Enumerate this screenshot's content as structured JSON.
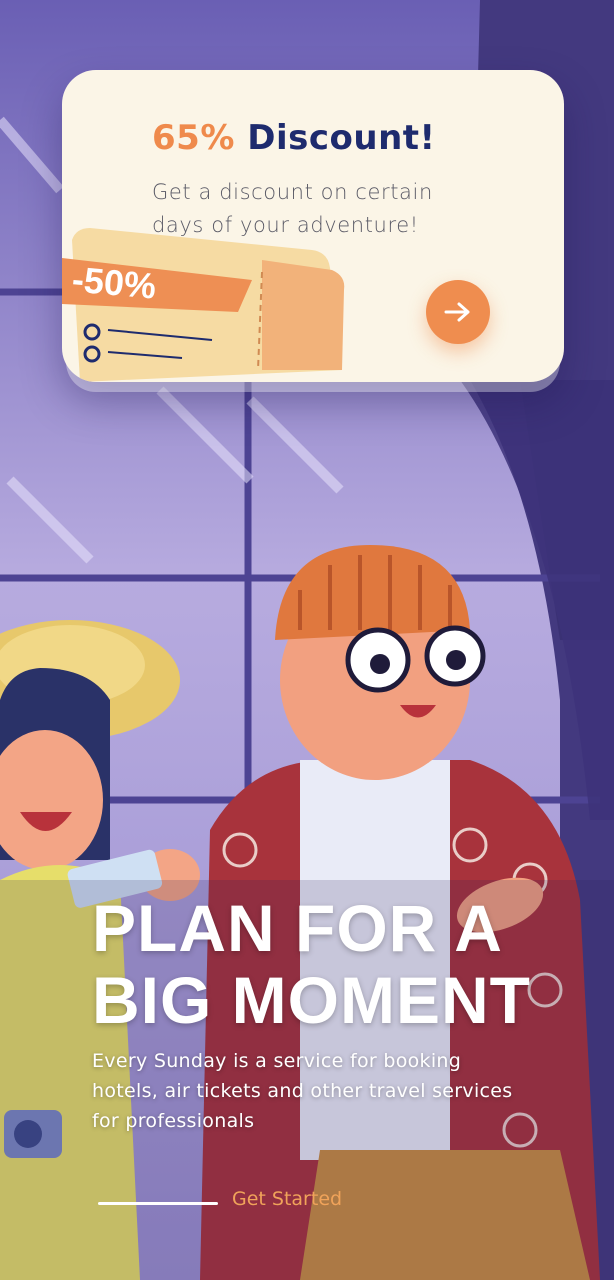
{
  "discount_card": {
    "percent": "65%",
    "word": "Discount!",
    "subtitle": "Get a discount on certain days of your adventure!",
    "ticket_tag": "-50%",
    "arrow_icon": "arrow-right-icon"
  },
  "hero": {
    "title_line1": "PLAN FOR A",
    "title_line2": "BIG MOMENT",
    "description": "Every Sunday is a service for booking hotels, air tickets and other travel services for professionals"
  },
  "onboarding": {
    "get_started_label": "Get Started"
  },
  "colors": {
    "accent_orange": "#ef8a4c",
    "title_navy": "#1e2b6e",
    "background_purple": "#5b4fa0",
    "card_cream": "#fbf5e7"
  }
}
